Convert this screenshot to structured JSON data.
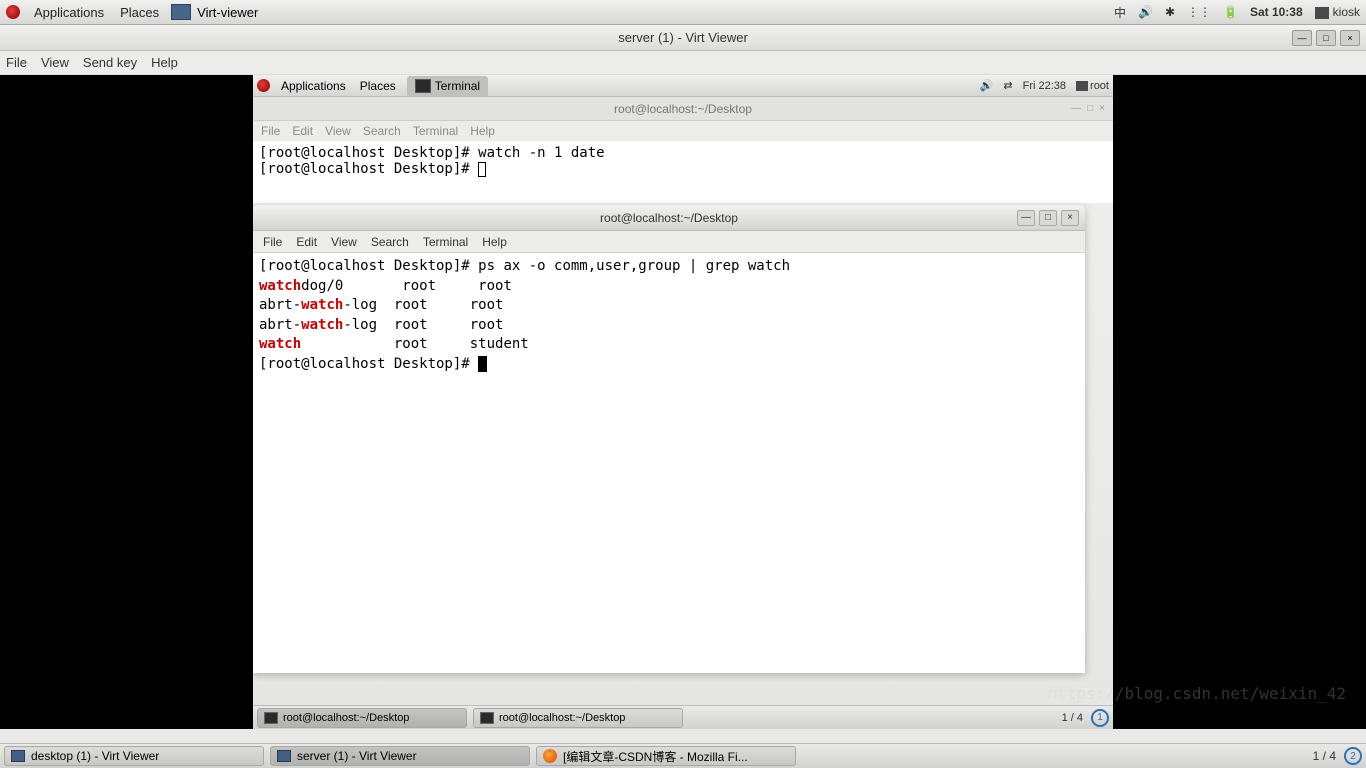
{
  "host_panel": {
    "apps": "Applications",
    "places": "Places",
    "app_name": "Virt-viewer",
    "input": "中",
    "clock": "Sat 10:38",
    "user": "kiosk"
  },
  "vv": {
    "title": "server (1) - Virt Viewer",
    "menu": {
      "file": "File",
      "view": "View",
      "sendkey": "Send key",
      "help": "Help"
    }
  },
  "guest_panel": {
    "apps": "Applications",
    "places": "Places",
    "task": "Terminal",
    "clock": "Fri 22:38",
    "user": "root"
  },
  "term_bg": {
    "title": "root@localhost:~/Desktop",
    "menu": {
      "file": "File",
      "edit": "Edit",
      "view": "View",
      "search": "Search",
      "terminal": "Terminal",
      "help": "Help"
    },
    "line1_prompt": "[root@localhost Desktop]# ",
    "line1_cmd": "watch -n 1 date",
    "line2_prompt": "[root@localhost Desktop]# "
  },
  "term_fg": {
    "title": "root@localhost:~/Desktop",
    "menu": {
      "file": "File",
      "edit": "Edit",
      "view": "View",
      "search": "Search",
      "terminal": "Terminal",
      "help": "Help"
    },
    "cmd_prompt": "[root@localhost Desktop]# ",
    "cmd": "ps ax -o comm,user,group | grep watch",
    "rows": [
      {
        "pre": "",
        "hl": "watch",
        "post": "dog/0       root     root"
      },
      {
        "pre": "abrt-",
        "hl": "watch",
        "post": "-log  root     root"
      },
      {
        "pre": "abrt-",
        "hl": "watch",
        "post": "-log  root     root"
      },
      {
        "pre": "",
        "hl": "watch",
        "post": "           root     student"
      }
    ],
    "final_prompt": "[root@localhost Desktop]# "
  },
  "guest_taskbar": {
    "task1": "root@localhost:~/Desktop",
    "task2": "root@localhost:~/Desktop",
    "ws": "1 / 4",
    "bubble": "1"
  },
  "host_taskbar": {
    "task1": "desktop (1) - Virt Viewer",
    "task2": "server (1) - Virt Viewer",
    "task3": "[编辑文章-CSDN博客 - Mozilla Fi...",
    "ws": "1 / 4",
    "bubble": "2"
  },
  "watermark": "https://blog.csdn.net/weixin_42"
}
